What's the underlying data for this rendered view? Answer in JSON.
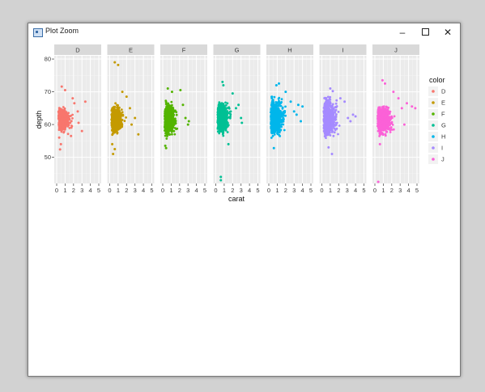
{
  "window": {
    "title": "Plot Zoom",
    "minimize_glyph": "–",
    "close_glyph": "✕",
    "icon": "plot-window-icon"
  },
  "chart_data": {
    "type": "scatter",
    "facets": [
      "D",
      "E",
      "F",
      "G",
      "H",
      "I",
      "J"
    ],
    "xlabel": "carat",
    "ylabel": "depth",
    "xlim": [
      0,
      5
    ],
    "ylim": [
      42,
      81
    ],
    "xticks": [
      0,
      1,
      2,
      3,
      4,
      5
    ],
    "yticks": [
      50,
      60,
      70,
      80
    ],
    "grid": true,
    "legend": {
      "title": "color",
      "position": "right"
    },
    "series": [
      {
        "name": "D",
        "color": "#F8766D",
        "core": {
          "x": [
            0.2,
            2.2
          ],
          "y": [
            57,
            66
          ]
        },
        "points": [
          [
            0.6,
            71.6
          ],
          [
            1.0,
            70.5
          ],
          [
            0.5,
            54
          ],
          [
            0.4,
            52.4
          ],
          [
            1.9,
            68
          ],
          [
            2.1,
            66.5
          ],
          [
            2.5,
            64
          ],
          [
            2.6,
            60.5
          ],
          [
            3.0,
            58
          ],
          [
            3.4,
            67
          ],
          [
            0.3,
            56
          ],
          [
            1.7,
            56.5
          ]
        ]
      },
      {
        "name": "E",
        "color": "#C49A00",
        "core": {
          "x": [
            0.2,
            2.1
          ],
          "y": [
            56,
            67
          ]
        },
        "points": [
          [
            0.6,
            79
          ],
          [
            1.0,
            78.2
          ],
          [
            0.4,
            51
          ],
          [
            0.6,
            52.5
          ],
          [
            1.5,
            70
          ],
          [
            2.0,
            68.5
          ],
          [
            2.4,
            65
          ],
          [
            2.6,
            60
          ],
          [
            3.0,
            62
          ],
          [
            3.4,
            57
          ],
          [
            0.3,
            54
          ]
        ]
      },
      {
        "name": "F",
        "color": "#53B400",
        "core": {
          "x": [
            0.2,
            2.1
          ],
          "y": [
            55,
            68
          ]
        },
        "points": [
          [
            0.4,
            52.8
          ],
          [
            0.6,
            71
          ],
          [
            1.1,
            70
          ],
          [
            2.1,
            70.5
          ],
          [
            2.4,
            66
          ],
          [
            2.7,
            62
          ],
          [
            3.0,
            60
          ],
          [
            3.1,
            61
          ],
          [
            0.3,
            53.5
          ]
        ]
      },
      {
        "name": "G",
        "color": "#00C094",
        "core": {
          "x": [
            0.2,
            2.3
          ],
          "y": [
            56,
            68
          ]
        },
        "points": [
          [
            0.6,
            44
          ],
          [
            0.6,
            43
          ],
          [
            0.8,
            73
          ],
          [
            0.9,
            72
          ],
          [
            1.5,
            54
          ],
          [
            2.0,
            69.5
          ],
          [
            2.4,
            65
          ],
          [
            2.7,
            66
          ],
          [
            3.0,
            62
          ],
          [
            3.1,
            60.5
          ]
        ]
      },
      {
        "name": "H",
        "color": "#00B6EB",
        "core": {
          "x": [
            0.2,
            2.3
          ],
          "y": [
            55,
            69
          ]
        },
        "points": [
          [
            0.6,
            52.8
          ],
          [
            0.9,
            72
          ],
          [
            1.2,
            72.5
          ],
          [
            2.0,
            70
          ],
          [
            2.6,
            67
          ],
          [
            3.0,
            64
          ],
          [
            3.5,
            66
          ],
          [
            3.3,
            63
          ],
          [
            4.0,
            65.5
          ],
          [
            3.8,
            61
          ]
        ]
      },
      {
        "name": "I",
        "color": "#A58AFF",
        "core": {
          "x": [
            0.2,
            2.4
          ],
          "y": [
            55,
            69
          ]
        },
        "points": [
          [
            0.8,
            53
          ],
          [
            1.2,
            51
          ],
          [
            1.0,
            71
          ],
          [
            1.3,
            70.2
          ],
          [
            2.2,
            68
          ],
          [
            2.7,
            67
          ],
          [
            3.1,
            62
          ],
          [
            3.4,
            61
          ],
          [
            3.7,
            63
          ],
          [
            4.0,
            62.5
          ]
        ]
      },
      {
        "name": "J",
        "color": "#FB61D7",
        "core": {
          "x": [
            0.3,
            2.8
          ],
          "y": [
            56,
            67
          ]
        },
        "points": [
          [
            0.4,
            42.5
          ],
          [
            0.9,
            73.5
          ],
          [
            1.2,
            72.5
          ],
          [
            2.2,
            70
          ],
          [
            2.8,
            68
          ],
          [
            3.2,
            65
          ],
          [
            3.8,
            66.5
          ],
          [
            4.4,
            65.5
          ],
          [
            4.8,
            65
          ],
          [
            3.5,
            60
          ],
          [
            0.6,
            54
          ]
        ]
      }
    ]
  }
}
